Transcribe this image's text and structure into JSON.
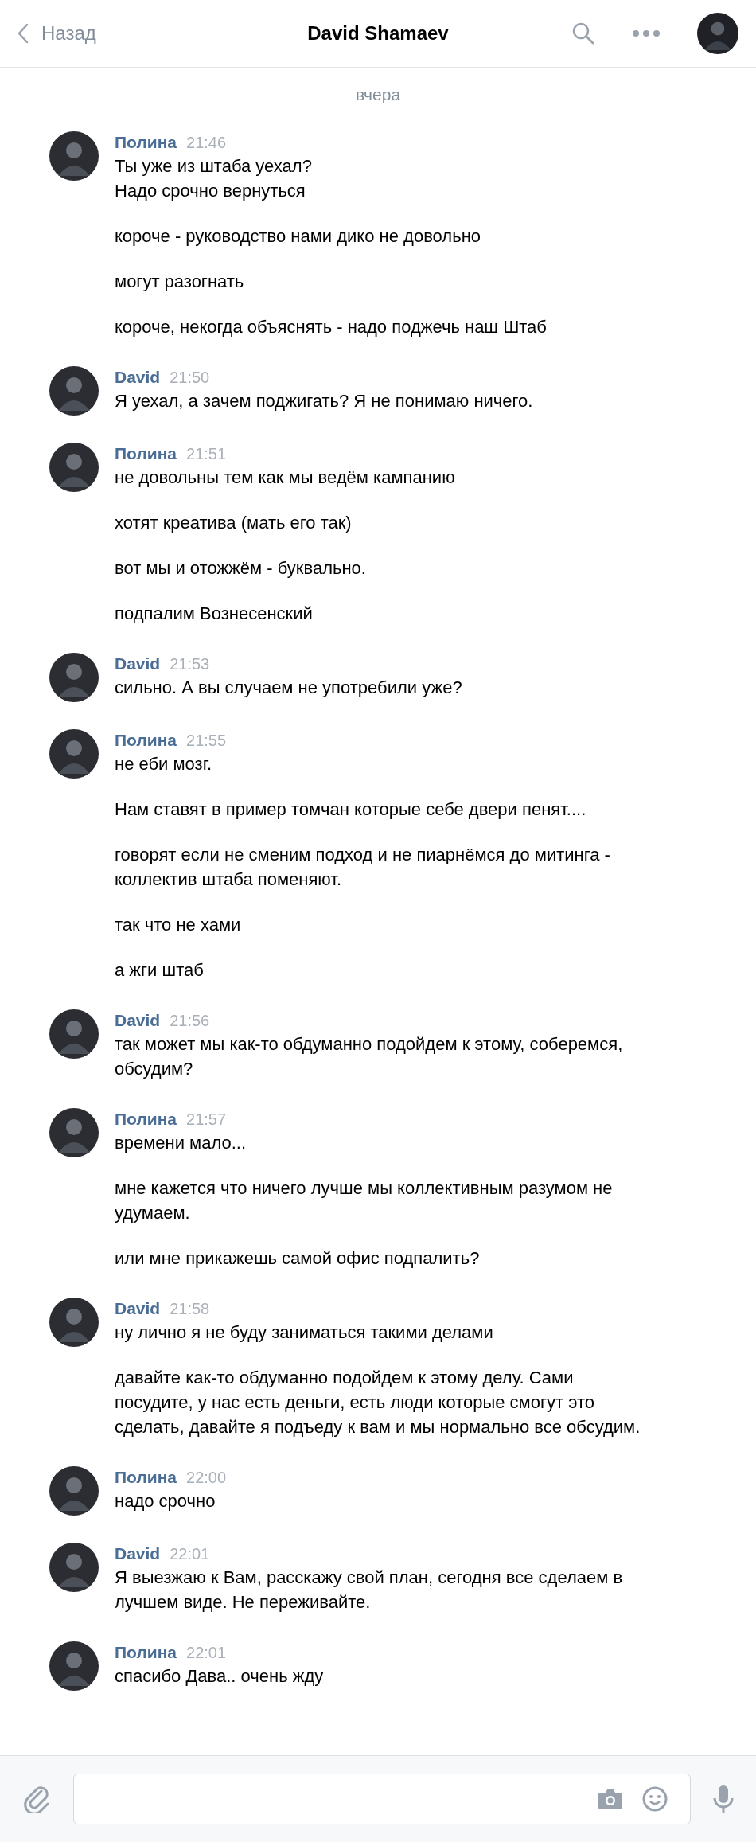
{
  "header": {
    "back_label": "Назад",
    "title": "David Shamaev"
  },
  "date_divider": "вчера",
  "messages": [
    {
      "author": "Полина",
      "time": "21:46",
      "paragraphs": [
        "Ты уже из штаба уехал?\nНадо срочно вернуться",
        "короче - руководство нами дико не довольно",
        "могут разогнать",
        "короче, некогда объяснять - надо поджечь наш Штаб"
      ]
    },
    {
      "author": "David",
      "time": "21:50",
      "paragraphs": [
        "Я уехал, а зачем поджигать? Я не понимаю ничего."
      ]
    },
    {
      "author": "Полина",
      "time": "21:51",
      "paragraphs": [
        "не довольны тем как мы ведём кампанию",
        "хотят креатива (мать его так)",
        "вот мы и отожжём - буквально.",
        "подпалим Вознесенский"
      ]
    },
    {
      "author": "David",
      "time": "21:53",
      "paragraphs": [
        "сильно. А вы случаем не употребили уже?"
      ]
    },
    {
      "author": "Полина",
      "time": "21:55",
      "paragraphs": [
        "не еби мозг.",
        "Нам ставят в пример томчан которые себе двери пенят....",
        "говорят если не сменим подход и не пиарнёмся до митинга - коллектив штаба поменяют.",
        "так что не хами",
        "а жги штаб"
      ]
    },
    {
      "author": "David",
      "time": "21:56",
      "paragraphs": [
        "так может мы как-то обдуманно подойдем к этому, соберемся, обсудим?"
      ]
    },
    {
      "author": "Полина",
      "time": "21:57",
      "paragraphs": [
        "времени мало...",
        "мне кажется что ничего лучше мы коллективным разумом не удумаем.",
        "или мне прикажешь самой офис подпалить?"
      ]
    },
    {
      "author": "David",
      "time": "21:58",
      "paragraphs": [
        "ну лично я не буду заниматься такими делами",
        "давайте как-то обдуманно подойдем к этому делу. Сами посудите, у нас есть деньги, есть люди которые смогут это сделать, давайте я подъеду к вам и мы нормально все обсудим."
      ]
    },
    {
      "author": "Полина",
      "time": "22:00",
      "paragraphs": [
        "надо срочно"
      ]
    },
    {
      "author": "David",
      "time": "22:01",
      "paragraphs": [
        "Я выезжаю к Вам, расскажу свой план, сегодня все сделаем в лучшем виде. Не переживайте."
      ]
    },
    {
      "author": "Полина",
      "time": "22:01",
      "paragraphs": [
        "спасибо Дава.. очень жду"
      ]
    }
  ]
}
